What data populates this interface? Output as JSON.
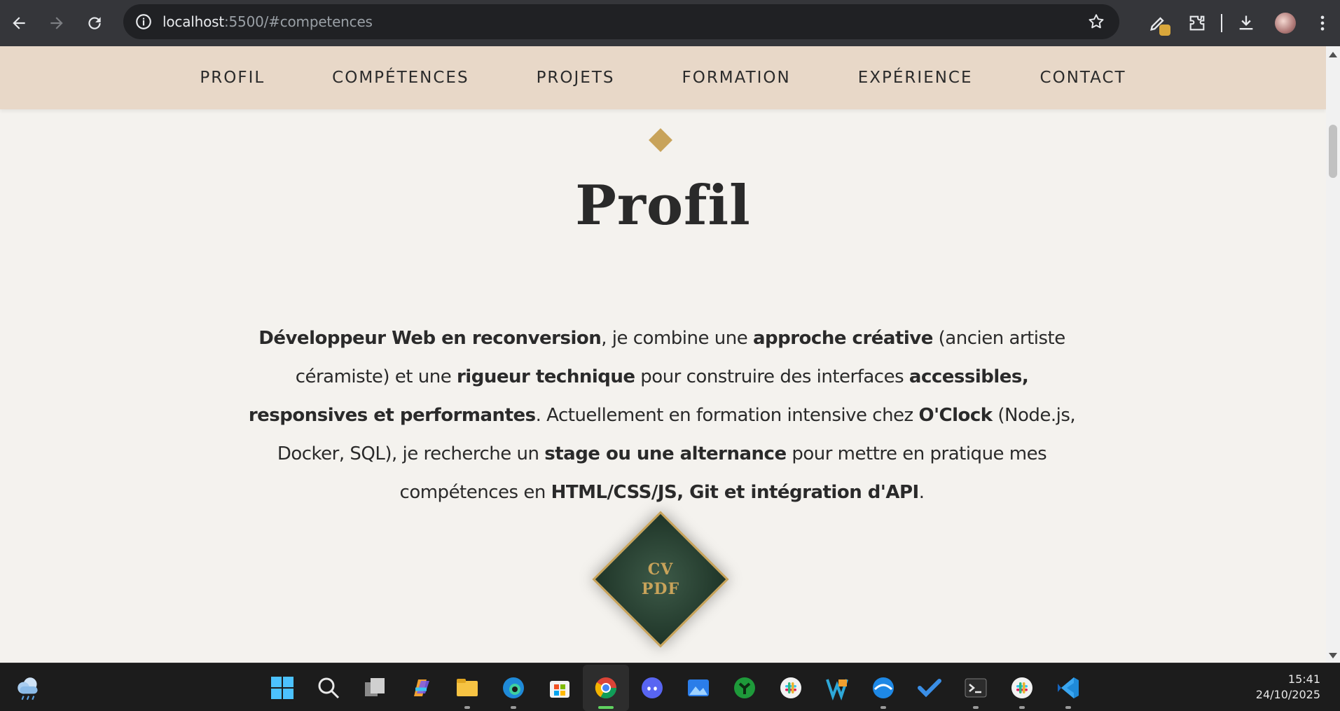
{
  "browser": {
    "url_host": "localhost",
    "url_rest": ":5500/#competences",
    "icons": [
      "back-icon",
      "forward-icon",
      "reload-icon",
      "site-info-icon",
      "bookmark-star-icon",
      "extension-edit-icon",
      "extensions-puzzle-icon",
      "download-icon",
      "profile-avatar",
      "more-menu-icon"
    ]
  },
  "site_nav": {
    "items": [
      {
        "label": "PROFIL"
      },
      {
        "label": "COMPÉTENCES"
      },
      {
        "label": "PROJETS"
      },
      {
        "label": "FORMATION"
      },
      {
        "label": "EXPÉRIENCE"
      },
      {
        "label": "CONTACT"
      }
    ]
  },
  "section": {
    "title": "Profil",
    "intro": [
      {
        "t": "Développeur Web en reconversion",
        "b": true
      },
      {
        "t": ", je combine une ",
        "b": false
      },
      {
        "t": "approche créative",
        "b": true
      },
      {
        "t": " (ancien artiste céramiste) et une ",
        "b": false
      },
      {
        "t": "rigueur technique",
        "b": true
      },
      {
        "t": " pour construire des interfaces ",
        "b": false
      },
      {
        "t": "accessibles, responsives et performantes",
        "b": true
      },
      {
        "t": ". Actuellement en formation intensive chez ",
        "b": false
      },
      {
        "t": "O'Clock",
        "b": true
      },
      {
        "t": " (Node.js, Docker, SQL), je recherche un ",
        "b": false
      },
      {
        "t": "stage ou une alternance",
        "b": true
      },
      {
        "t": " pour mettre en pratique mes compétences en ",
        "b": false
      },
      {
        "t": "HTML/CSS/JS, Git et intégration d'API",
        "b": true
      },
      {
        "t": ".",
        "b": false
      }
    ],
    "cv_button": {
      "line1": "CV",
      "line2": "PDF"
    }
  },
  "colors": {
    "nav_bg": "#e8d8c8",
    "page_bg": "#f4f2ee",
    "accent_gold": "#c8a35a",
    "cv_green": "#2a4636"
  },
  "taskbar": {
    "apps": [
      {
        "name": "start-icon"
      },
      {
        "name": "search-icon"
      },
      {
        "name": "task-view-icon"
      },
      {
        "name": "copilot-icon"
      },
      {
        "name": "file-explorer-icon"
      },
      {
        "name": "edge-icon"
      },
      {
        "name": "store-icon"
      },
      {
        "name": "chrome-icon"
      },
      {
        "name": "discord-icon"
      },
      {
        "name": "photos-icon"
      },
      {
        "name": "app-green-icon"
      },
      {
        "name": "slack-icon"
      },
      {
        "name": "app-vs-icon"
      },
      {
        "name": "app-blue-icon"
      },
      {
        "name": "todo-icon"
      },
      {
        "name": "terminal-icon"
      },
      {
        "name": "slack-2-icon"
      },
      {
        "name": "vscode-icon"
      }
    ],
    "time": "15:41",
    "date": "24/10/2025"
  }
}
